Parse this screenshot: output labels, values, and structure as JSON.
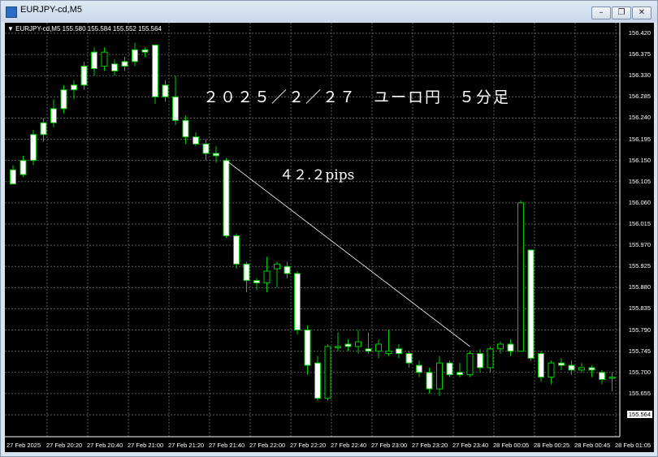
{
  "window": {
    "title": "EURJPY-cd,M5",
    "buttons": {
      "minimize": "–",
      "restore": "❐",
      "close": "✕"
    }
  },
  "chart": {
    "symbol_info": "▼ EURJPY-cd,M5  155.580 155.584 155.552 155.564",
    "annotation_title": "２０２５／２／２７　ユーロ円　５分足",
    "annotation_pips": "４２.２pips",
    "current_price": "155.564",
    "price_axis": [
      "156.420",
      "156.375",
      "156.330",
      "156.285",
      "156.240",
      "156.195",
      "156.150",
      "156.105",
      "156.060",
      "156.015",
      "155.970",
      "155.925",
      "155.880",
      "155.835",
      "155.790",
      "155.745",
      "155.700",
      "155.655",
      "155.610"
    ],
    "time_axis": [
      "27 Feb 2025",
      "27 Feb 20:20",
      "27 Feb 20:40",
      "27 Feb 21:00",
      "27 Feb 21:20",
      "27 Feb 21:40",
      "27 Feb 22:00",
      "27 Feb 22:20",
      "27 Feb 22:40",
      "27 Feb 23:00",
      "27 Feb 23:20",
      "27 Feb 23:40",
      "28 Feb 00:05",
      "28 Feb 00:25",
      "28 Feb 00:45",
      "28 Feb 01:05"
    ],
    "colors": {
      "background": "#000000",
      "grid": "#5a5a5a",
      "bull": "#000000",
      "bear": "#ffffff",
      "wick": "#00cc00",
      "text": "#ffffff"
    },
    "candles": [
      [
        156.13,
        156.1,
        156.1,
        156.14
      ],
      [
        156.15,
        156.12,
        156.115,
        156.16
      ],
      [
        156.205,
        156.15,
        156.14,
        156.215
      ],
      [
        156.23,
        156.205,
        156.19,
        156.24
      ],
      [
        156.26,
        156.23,
        156.22,
        156.28
      ],
      [
        156.3,
        156.26,
        156.25,
        156.31
      ],
      [
        156.31,
        156.3,
        156.28,
        156.32
      ],
      [
        156.35,
        156.31,
        156.3,
        156.36
      ],
      [
        156.38,
        156.345,
        156.33,
        156.39
      ],
      [
        156.35,
        156.38,
        156.34,
        156.39
      ],
      [
        156.355,
        156.34,
        156.33,
        156.365
      ],
      [
        156.36,
        156.35,
        156.34,
        156.37
      ],
      [
        156.385,
        156.36,
        156.35,
        156.4
      ],
      [
        156.385,
        156.38,
        156.37,
        156.39
      ],
      [
        156.395,
        156.285,
        156.27,
        156.395
      ],
      [
        156.31,
        156.285,
        156.275,
        156.32
      ],
      [
        156.285,
        156.235,
        156.225,
        156.33
      ],
      [
        156.235,
        156.2,
        156.185,
        156.245
      ],
      [
        156.2,
        156.185,
        156.18,
        156.21
      ],
      [
        156.185,
        156.165,
        156.15,
        156.195
      ],
      [
        156.165,
        156.16,
        156.145,
        156.18
      ],
      [
        156.15,
        155.99,
        155.985,
        156.155
      ],
      [
        155.99,
        155.93,
        155.92,
        155.995
      ],
      [
        155.93,
        155.895,
        155.87,
        155.935
      ],
      [
        155.895,
        155.89,
        155.875,
        155.9
      ],
      [
        155.89,
        155.915,
        155.87,
        155.945
      ],
      [
        155.92,
        155.93,
        155.88,
        155.935
      ],
      [
        155.925,
        155.91,
        155.9,
        155.935
      ],
      [
        155.91,
        155.79,
        155.78,
        155.915
      ],
      [
        155.79,
        155.715,
        155.695,
        155.8
      ],
      [
        155.72,
        155.645,
        155.64,
        155.735
      ],
      [
        155.645,
        155.755,
        155.64,
        155.76
      ],
      [
        155.755,
        155.755,
        155.745,
        155.785
      ],
      [
        155.76,
        155.755,
        155.745,
        155.77
      ],
      [
        155.755,
        155.765,
        155.74,
        155.79
      ],
      [
        155.75,
        155.745,
        155.74,
        155.785
      ],
      [
        155.745,
        155.76,
        155.73,
        155.77
      ],
      [
        155.74,
        155.745,
        155.735,
        155.79
      ],
      [
        155.75,
        155.74,
        155.73,
        155.76
      ],
      [
        155.74,
        155.72,
        155.71,
        155.745
      ],
      [
        155.715,
        155.7,
        155.69,
        155.725
      ],
      [
        155.7,
        155.665,
        155.655,
        155.71
      ],
      [
        155.665,
        155.72,
        155.65,
        155.735
      ],
      [
        155.72,
        155.695,
        155.69,
        155.725
      ],
      [
        155.7,
        155.695,
        155.69,
        155.72
      ],
      [
        155.695,
        155.74,
        155.69,
        155.745
      ],
      [
        155.74,
        155.71,
        155.7,
        155.75
      ],
      [
        155.71,
        155.75,
        155.7,
        155.755
      ],
      [
        155.75,
        155.76,
        155.74,
        155.765
      ],
      [
        155.76,
        155.745,
        155.735,
        155.77
      ],
      [
        155.745,
        156.06,
        155.745,
        156.065
      ],
      [
        155.96,
        155.73,
        155.725,
        155.96
      ],
      [
        155.74,
        155.69,
        155.68,
        155.745
      ],
      [
        155.69,
        155.72,
        155.675,
        155.725
      ],
      [
        155.72,
        155.715,
        155.705,
        155.73
      ],
      [
        155.715,
        155.705,
        155.695,
        155.725
      ],
      [
        155.705,
        155.71,
        155.7,
        155.72
      ],
      [
        155.71,
        155.705,
        155.69,
        155.715
      ],
      [
        155.7,
        155.685,
        155.675,
        155.705
      ],
      [
        155.69,
        155.69,
        155.66,
        155.7
      ],
      [
        155.695,
        155.69,
        155.64,
        155.71
      ],
      [
        155.69,
        155.685,
        155.6,
        155.72
      ],
      [
        155.685,
        155.64,
        155.61,
        155.7
      ],
      [
        155.64,
        155.625,
        155.6,
        155.66
      ]
    ]
  }
}
